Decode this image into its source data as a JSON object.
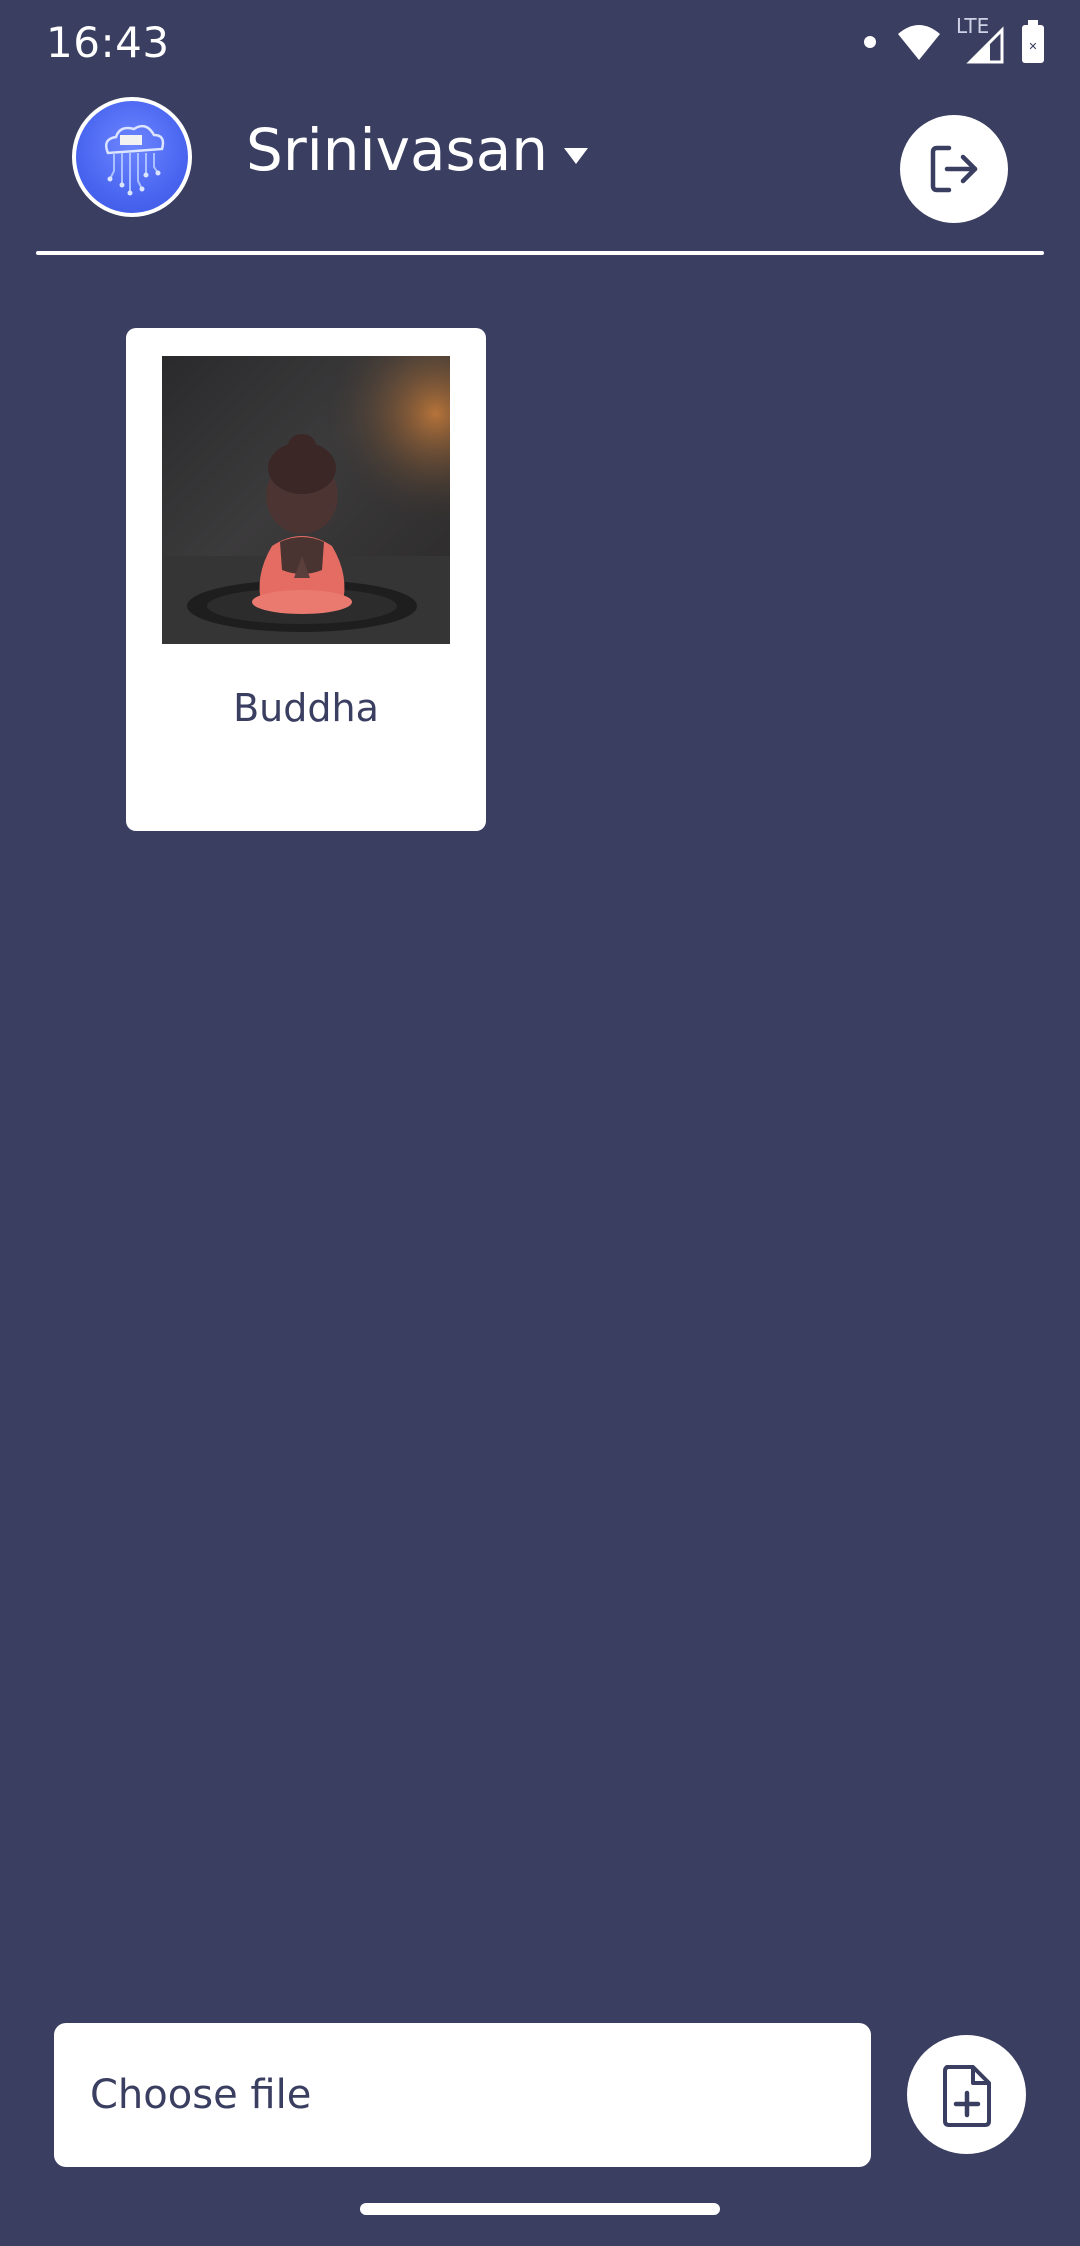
{
  "status_bar": {
    "time": "16:43",
    "network_label": "LTE",
    "icons": [
      "notification-dot-icon",
      "wifi-icon",
      "cell-signal-icon",
      "battery-icon"
    ]
  },
  "header": {
    "account_name": "Srinivasan",
    "avatar_icon": "cloud-circuit-logo",
    "logout_icon": "logout-icon"
  },
  "items": [
    {
      "title": "Buddha",
      "image": "buddha-figurine-photo"
    }
  ],
  "footer": {
    "choose_file_label": "Choose file",
    "add_file_icon": "add-file-icon"
  },
  "colors": {
    "background": "#3a3e60",
    "card": "#ffffff",
    "text_dark": "#3a3e60",
    "avatar_blue": "#4a66f0"
  }
}
